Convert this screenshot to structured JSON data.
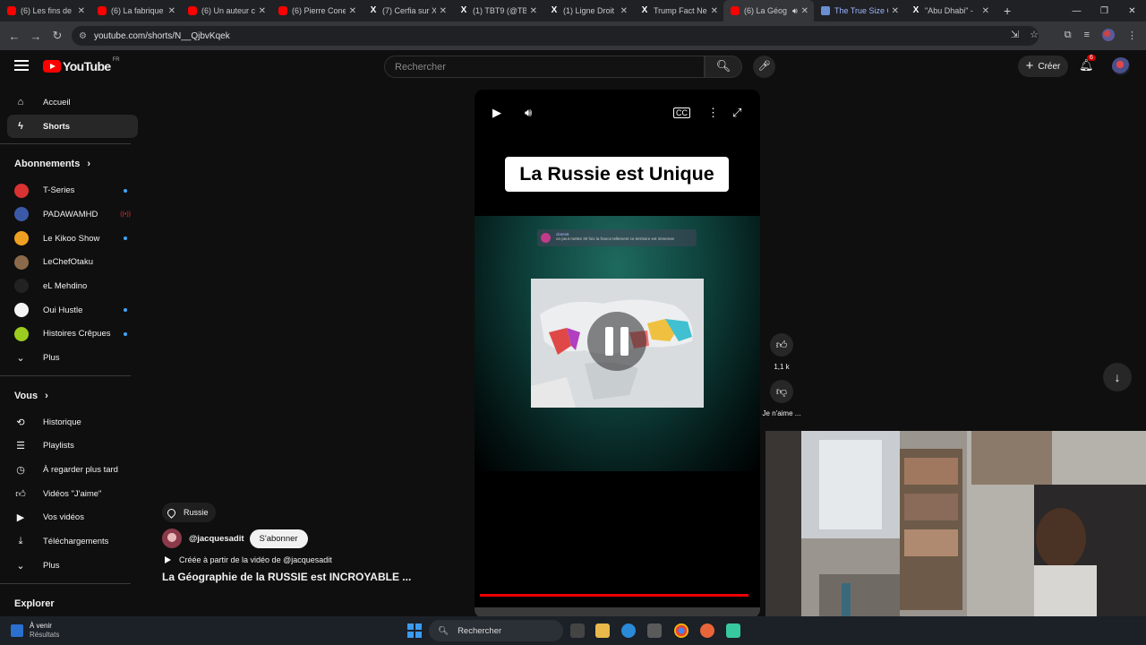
{
  "browser": {
    "tabs": [
      {
        "title": "(6) Les fins de ",
        "kind": "youtube"
      },
      {
        "title": "(6) La fabrique ",
        "kind": "youtube"
      },
      {
        "title": "(6) Un auteur c",
        "kind": "youtube"
      },
      {
        "title": "(6) Pierre Cone",
        "kind": "youtube"
      },
      {
        "title": "(7) Cerfia sur X",
        "kind": "x"
      },
      {
        "title": "(1) TBT9 (@TBT",
        "kind": "x"
      },
      {
        "title": "(1) Ligne Droit",
        "kind": "x"
      },
      {
        "title": "Trump Fact Ne",
        "kind": "x"
      },
      {
        "title": "(6) La Géog",
        "kind": "youtube",
        "active": true,
        "audio": true
      },
      {
        "title": "The True Size O",
        "kind": "web"
      },
      {
        "title": "\"Abu Dhabi\" - ",
        "kind": "x"
      }
    ],
    "url": "youtube.com/shorts/N__QjbvKqek"
  },
  "header": {
    "logo_text": "YouTube",
    "region": "FR",
    "search_placeholder": "Rechercher",
    "create_label": "Créer",
    "notif_count": "6"
  },
  "sidebar": {
    "main": [
      {
        "label": "Accueil",
        "icon": "home-icon"
      },
      {
        "label": "Shorts",
        "icon": "shorts-icon",
        "selected": true
      }
    ],
    "subs_title": "Abonnements",
    "subs": [
      {
        "label": "T-Series",
        "color": "#d93232",
        "indicator": "dot"
      },
      {
        "label": "PADAWAMHD",
        "color": "#3a5aa8",
        "indicator": "live"
      },
      {
        "label": "Le Kikoo Show",
        "color": "#f0a020",
        "indicator": "dot"
      },
      {
        "label": "LeChefOtaku",
        "color": "#8a6a4a",
        "indicator": ""
      },
      {
        "label": "eL Mehdino",
        "color": "#222222",
        "indicator": ""
      },
      {
        "label": "Oui Hustle",
        "color": "#f4f4f4",
        "indicator": "dot"
      },
      {
        "label": "Histoires Crêpues",
        "color": "#9ccc20",
        "indicator": "dot"
      }
    ],
    "subs_more": "Plus",
    "you_title": "Vous",
    "you": [
      {
        "label": "Historique",
        "icon": "history-icon"
      },
      {
        "label": "Playlists",
        "icon": "playlists-icon"
      },
      {
        "label": "À regarder plus tard",
        "icon": "watch-later-icon"
      },
      {
        "label": "Vidéos \"J'aime\"",
        "icon": "liked-videos-icon"
      },
      {
        "label": "Vos vidéos",
        "icon": "your-videos-icon"
      },
      {
        "label": "Téléchargements",
        "icon": "downloads-icon"
      }
    ],
    "you_more": "Plus",
    "explore_title": "Explorer"
  },
  "short": {
    "location": "Russie",
    "channel": "@jacquesadit",
    "subscribe_label": "S'abonner",
    "created_from": "Créée à partir de la vidéo de @jacquesadit",
    "title": "La Géographie de la RUSSIE est INCROYABLE ...",
    "overlay_title": "La Russie est Unique",
    "comment_user": "clarex6",
    "comment_text": "on peut mettre 30 fois la france tellement ce territoire est immense",
    "likes": "1,1 k",
    "dislike_label": "Je n'aime ...",
    "progress": 0.98
  },
  "taskbar": {
    "weather_title": "À venir",
    "weather_sub": "Résultats",
    "search_placeholder": "Rechercher"
  }
}
